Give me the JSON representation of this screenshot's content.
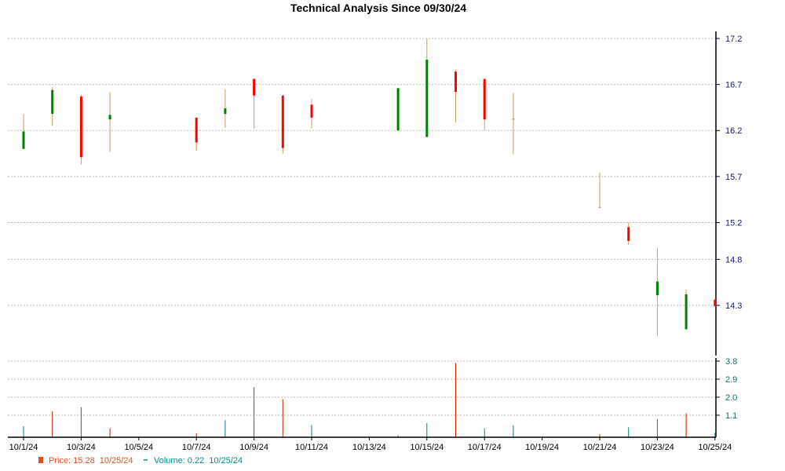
{
  "chart_data": [
    {
      "type": "candlestick",
      "title": "Technical Analysis Since 09/30/24",
      "xlabel": "",
      "ylabel": "",
      "x_tick_labels": [
        "10/1/24",
        "10/3/24",
        "10/5/24",
        "10/7/24",
        "10/9/24",
        "10/11/24",
        "10/13/24",
        "10/15/24",
        "10/17/24",
        "10/19/24",
        "10/21/24",
        "10/23/24",
        "10/25/24"
      ],
      "y_ticks": [
        14.3,
        14.8,
        15.2,
        15.7,
        16.2,
        16.7,
        17.2
      ],
      "ylim": [
        13.85,
        17.3
      ],
      "grid": true,
      "colors": {
        "up": "#008000",
        "down": "#ff0000",
        "wick": "#c8a060",
        "flat": "#c8a060"
      },
      "candles": [
        {
          "date": "10/1/24",
          "open": 16.0,
          "high": 16.38,
          "low": 16.0,
          "close": 16.19
        },
        {
          "date": "10/2/24",
          "open": 16.38,
          "high": 16.67,
          "low": 16.25,
          "close": 16.64
        },
        {
          "date": "10/3/24",
          "open": 16.57,
          "high": 16.59,
          "low": 15.83,
          "close": 15.91
        },
        {
          "date": "10/4/24",
          "open": 16.32,
          "high": 16.62,
          "low": 15.97,
          "close": 16.37
        },
        {
          "date": "10/7/24",
          "open": 16.34,
          "high": 16.34,
          "low": 15.98,
          "close": 16.07
        },
        {
          "date": "10/8/24",
          "open": 16.38,
          "high": 16.65,
          "low": 16.23,
          "close": 16.44
        },
        {
          "date": "10/9/24",
          "open": 16.76,
          "high": 16.76,
          "low": 16.22,
          "close": 16.58
        },
        {
          "date": "10/10/24",
          "open": 16.58,
          "high": 16.58,
          "low": 15.95,
          "close": 16.01
        },
        {
          "date": "10/11/24",
          "open": 16.48,
          "high": 16.54,
          "low": 16.22,
          "close": 16.34
        },
        {
          "date": "10/14/24",
          "open": 16.2,
          "high": 16.66,
          "low": 16.2,
          "close": 16.66
        },
        {
          "date": "10/15/24",
          "open": 16.13,
          "high": 17.2,
          "low": 16.13,
          "close": 16.97
        },
        {
          "date": "10/16/24",
          "open": 16.84,
          "high": 16.86,
          "low": 16.29,
          "close": 16.62
        },
        {
          "date": "10/17/24",
          "open": 16.76,
          "high": 16.76,
          "low": 16.2,
          "close": 16.32
        },
        {
          "date": "10/18/24",
          "open": 16.33,
          "high": 16.61,
          "low": 15.94,
          "close": 16.33
        },
        {
          "date": "10/21/24",
          "open": 15.37,
          "high": 15.74,
          "low": 15.36,
          "close": 15.37
        },
        {
          "date": "10/22/24",
          "open": 15.15,
          "high": 15.2,
          "low": 14.96,
          "close": 15.0
        },
        {
          "date": "10/23/24",
          "open": 14.41,
          "high": 14.92,
          "low": 13.97,
          "close": 14.56
        },
        {
          "date": "10/24/24",
          "open": 14.04,
          "high": 14.47,
          "low": 14.04,
          "close": 14.42
        },
        {
          "date": "10/25/24",
          "open": 14.36,
          "high": 14.38,
          "low": 14.29,
          "close": 14.29
        }
      ]
    },
    {
      "type": "bar",
      "title": "",
      "y_ticks": [
        1.1,
        2.0,
        2.9,
        3.8
      ],
      "ylim": [
        0,
        3.8
      ],
      "grid": true,
      "colors": {
        "up": "#008080",
        "down": "#cc2200"
      },
      "bars": [
        {
          "date": "10/1/24",
          "value": 0.55,
          "dir": "up"
        },
        {
          "date": "10/2/24",
          "value": 1.3,
          "dir": "down"
        },
        {
          "date": "10/3/24",
          "value": 1.5,
          "dir": "up"
        },
        {
          "date": "10/4/24",
          "value": 0.45,
          "dir": "down"
        },
        {
          "date": "10/7/24",
          "value": 0.2,
          "dir": "down"
        },
        {
          "date": "10/8/24",
          "value": 0.85,
          "dir": "up"
        },
        {
          "date": "10/9/24",
          "value": 2.5,
          "dir": "up"
        },
        {
          "date": "10/10/24",
          "value": 1.9,
          "dir": "down"
        },
        {
          "date": "10/11/24",
          "value": 0.6,
          "dir": "up"
        },
        {
          "date": "10/14/24",
          "value": 0.1,
          "dir": "down"
        },
        {
          "date": "10/15/24",
          "value": 0.7,
          "dir": "up"
        },
        {
          "date": "10/16/24",
          "value": 3.7,
          "dir": "down"
        },
        {
          "date": "10/17/24",
          "value": 0.45,
          "dir": "up"
        },
        {
          "date": "10/18/24",
          "value": 0.6,
          "dir": "up"
        },
        {
          "date": "10/21/24",
          "value": 0.15,
          "dir": "down"
        },
        {
          "date": "10/22/24",
          "value": 0.5,
          "dir": "up"
        },
        {
          "date": "10/23/24",
          "value": 0.9,
          "dir": "up"
        },
        {
          "date": "10/24/24",
          "value": 1.2,
          "dir": "down"
        },
        {
          "date": "10/25/24",
          "value": 0.22,
          "dir": "up"
        }
      ]
    }
  ],
  "legend": {
    "price_label": "Price: 15.28",
    "price_date": "10/25/24",
    "price_color": "#e05020",
    "volume_label": "Volume: 0.22",
    "volume_date": "10/25/24",
    "volume_color": "#009090"
  }
}
